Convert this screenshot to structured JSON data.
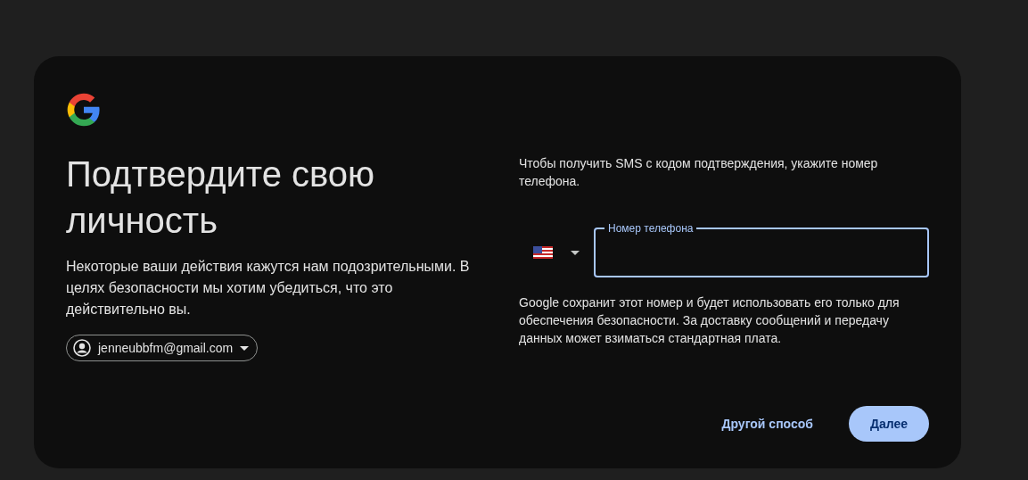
{
  "heading": "Подтвердите свою личность",
  "description": "Некоторые ваши действия кажутся нам подозрительными. В целях безопасности мы хотим убедиться, что это действительно вы.",
  "account": {
    "email": "jenneubbfm@gmail.com"
  },
  "instruction": "Чтобы получить SMS с кодом подтверждения, укажите номер телефона.",
  "phone_field": {
    "label": "Номер телефона",
    "focused": true
  },
  "note": "Google сохранит этот номер и будет использовать его только для обеспечения безопасности. За доставку сообщений и передачу данных может взиматься стандартная плата.",
  "buttons": [
    {
      "label": "Другой способ",
      "kind": "text"
    },
    {
      "label": "Далее",
      "kind": "filled"
    }
  ]
}
